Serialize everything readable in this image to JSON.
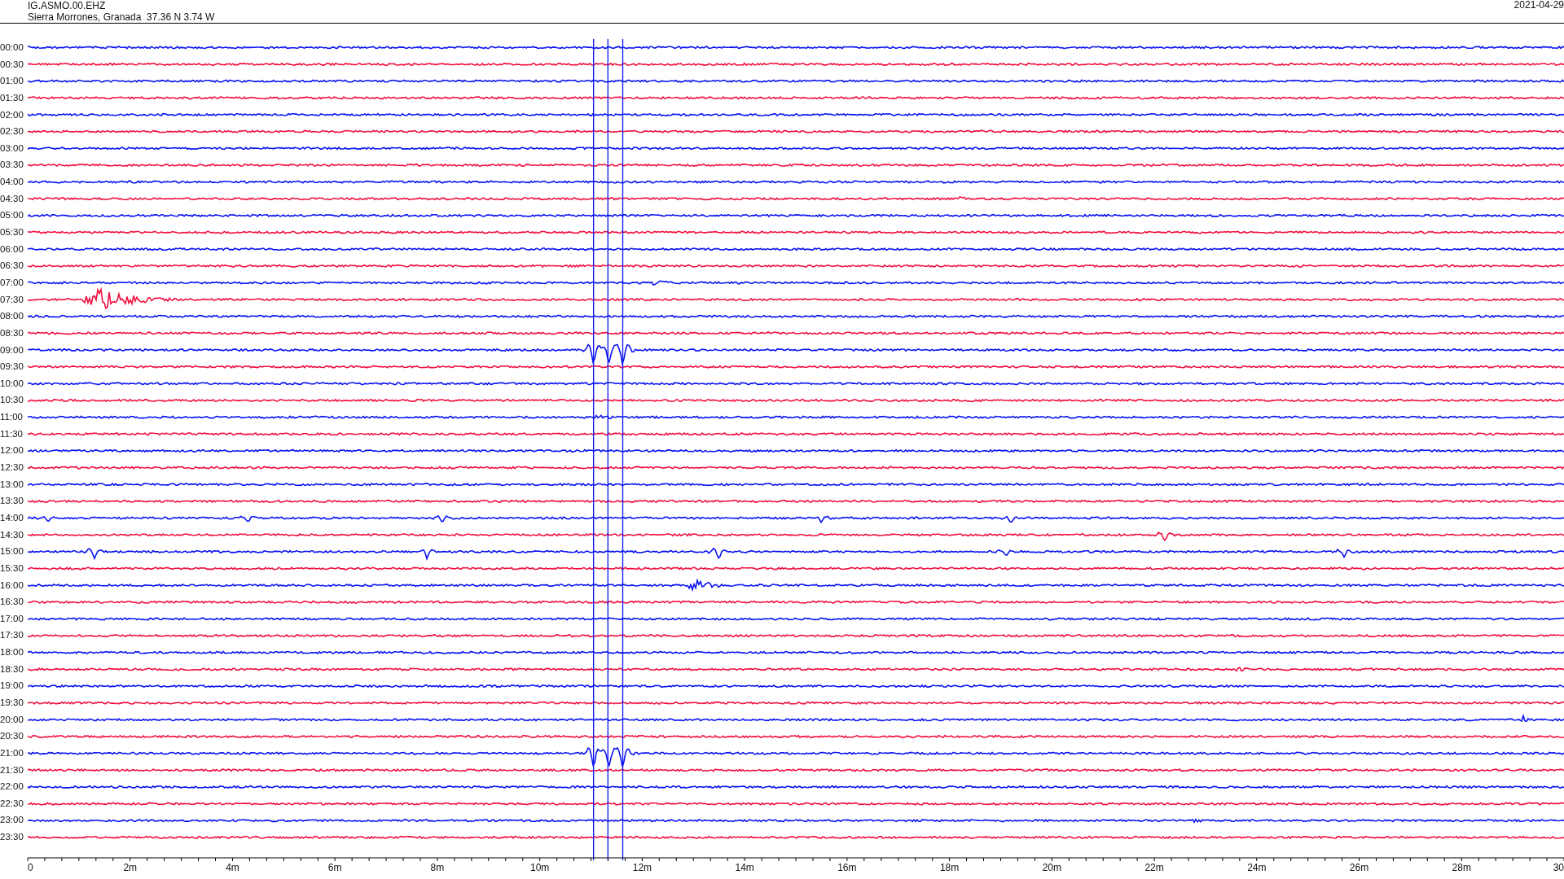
{
  "header": {
    "station": "IG.ASMO.00.EHZ",
    "location": "Sierra Morrones, Granada  37.36 N 3.74 W",
    "date": "2021-04-29"
  },
  "rows": [
    {
      "time": "00:00",
      "color": "#0a14f0"
    },
    {
      "time": "00:30",
      "color": "#f01040"
    },
    {
      "time": "01:00",
      "color": "#0a14f0"
    },
    {
      "time": "01:30",
      "color": "#f01040"
    },
    {
      "time": "02:00",
      "color": "#0a14f0"
    },
    {
      "time": "02:30",
      "color": "#f01040"
    },
    {
      "time": "03:00",
      "color": "#0a14f0"
    },
    {
      "time": "03:30",
      "color": "#f01040"
    },
    {
      "time": "04:00",
      "color": "#0a14f0"
    },
    {
      "time": "04:30",
      "color": "#f01040"
    },
    {
      "time": "05:00",
      "color": "#0a14f0"
    },
    {
      "time": "05:30",
      "color": "#f01040"
    },
    {
      "time": "06:00",
      "color": "#0a14f0"
    },
    {
      "time": "06:30",
      "color": "#f01040"
    },
    {
      "time": "07:00",
      "color": "#0a14f0"
    },
    {
      "time": "07:30",
      "color": "#f01040"
    },
    {
      "time": "08:00",
      "color": "#0a14f0"
    },
    {
      "time": "08:30",
      "color": "#f01040"
    },
    {
      "time": "09:00",
      "color": "#0a14f0"
    },
    {
      "time": "09:30",
      "color": "#f01040"
    },
    {
      "time": "10:00",
      "color": "#0a14f0"
    },
    {
      "time": "10:30",
      "color": "#f01040"
    },
    {
      "time": "11:00",
      "color": "#0a14f0"
    },
    {
      "time": "11:30",
      "color": "#f01040"
    },
    {
      "time": "12:00",
      "color": "#0a14f0"
    },
    {
      "time": "12:30",
      "color": "#f01040"
    },
    {
      "time": "13:00",
      "color": "#0a14f0"
    },
    {
      "time": "13:30",
      "color": "#f01040"
    },
    {
      "time": "14:00",
      "color": "#0a14f0"
    },
    {
      "time": "14:30",
      "color": "#f01040"
    },
    {
      "time": "15:00",
      "color": "#0a14f0"
    },
    {
      "time": "15:30",
      "color": "#f01040"
    },
    {
      "time": "16:00",
      "color": "#0a14f0"
    },
    {
      "time": "16:30",
      "color": "#f01040"
    },
    {
      "time": "17:00",
      "color": "#0a14f0"
    },
    {
      "time": "17:30",
      "color": "#f01040"
    },
    {
      "time": "18:00",
      "color": "#0a14f0"
    },
    {
      "time": "18:30",
      "color": "#f01040"
    },
    {
      "time": "19:00",
      "color": "#0a14f0"
    },
    {
      "time": "19:30",
      "color": "#f01040"
    },
    {
      "time": "20:00",
      "color": "#0a14f0"
    },
    {
      "time": "20:30",
      "color": "#f01040"
    },
    {
      "time": "21:00",
      "color": "#0a14f0"
    },
    {
      "time": "21:30",
      "color": "#f01040"
    },
    {
      "time": "22:00",
      "color": "#0a14f0"
    },
    {
      "time": "22:30",
      "color": "#f01040"
    },
    {
      "time": "23:00",
      "color": "#0a14f0"
    },
    {
      "time": "23:30",
      "color": "#f01040"
    }
  ],
  "x_axis": {
    "tick_labels": [
      "0",
      "2m",
      "4m",
      "6m",
      "8m",
      "10m",
      "12m",
      "14m",
      "16m",
      "18m",
      "20m",
      "22m",
      "24m",
      "26m",
      "28m",
      "30"
    ]
  }
}
